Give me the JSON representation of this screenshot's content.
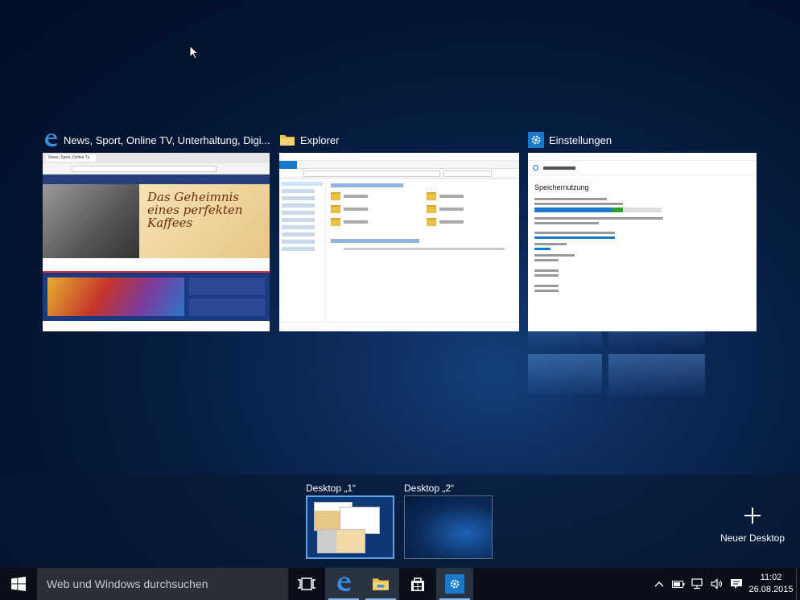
{
  "windows": [
    {
      "title": "News, Sport, Online TV, Unterhaltung, Digi...",
      "app": "edge",
      "thumb": {
        "tab": "News, Sport, Online Tv, Unter...",
        "headline": "Das Geheimnis eines perfekten Kaffees"
      }
    },
    {
      "title": "Explorer",
      "app": "explorer"
    },
    {
      "title": "Einstellungen",
      "app": "settings",
      "thumb": {
        "heading": "Speichernutzung"
      }
    }
  ],
  "desktops": [
    {
      "label": "Desktop „1“",
      "selected": true
    },
    {
      "label": "Desktop „2“",
      "selected": false
    }
  ],
  "new_desktop": {
    "label": "Neuer Desktop",
    "icon": "plus-icon"
  },
  "taskbar": {
    "search_placeholder": "Web und Windows durchsuchen",
    "apps": [
      "task-view-icon",
      "edge-icon",
      "file-explorer-icon",
      "store-icon",
      "settings-icon"
    ]
  },
  "tray": {
    "time": "11:02",
    "date": "26.08.2015"
  },
  "colors": {
    "accent": "#1979ca",
    "taskbar": "#0a0f19",
    "folder": "#e8c04a"
  }
}
